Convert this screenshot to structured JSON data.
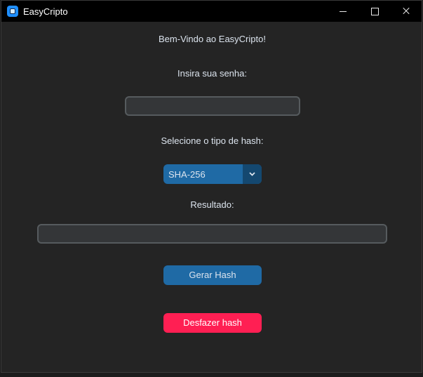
{
  "window": {
    "title": "EasyCripto",
    "controls": {
      "minimize": "minimize",
      "maximize": "maximize",
      "close": "close"
    }
  },
  "main": {
    "welcome": "Bem-Vindo ao EasyCripto!",
    "password_label": "Insira sua senha:",
    "password_value": "",
    "hash_type_label": "Selecione o tipo de hash:",
    "hash_type_selected": "SHA-256",
    "result_label": "Resultado:",
    "result_value": "",
    "generate_button": "Gerar Hash",
    "undo_button": "Desfazer hash"
  },
  "colors": {
    "background": "#242424",
    "accent": "#1f6aa5",
    "accent_dark": "#144870",
    "danger": "#ff1f53",
    "entry_bg": "#343638",
    "entry_border": "#565b5e"
  }
}
